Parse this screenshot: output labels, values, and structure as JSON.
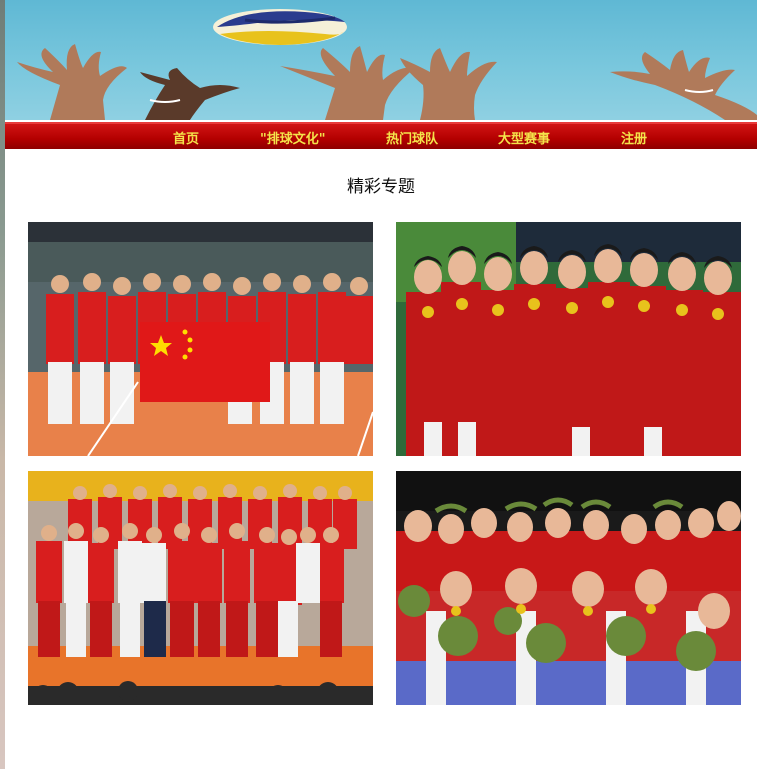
{
  "nav": {
    "items": [
      "首页",
      "\"排球文化\"",
      "热门球队",
      "大型赛事",
      "注册"
    ]
  },
  "section": {
    "title": "精彩专题"
  },
  "photos": [
    {
      "name": "photo-team-with-flag",
      "desc": ""
    },
    {
      "name": "photo-players-with-medals",
      "desc": ""
    },
    {
      "name": "photo-team-group",
      "desc": ""
    },
    {
      "name": "photo-medal-ceremony",
      "desc": ""
    }
  ],
  "colors": {
    "nav_bg": "#b30000",
    "nav_text": "#f4e34a",
    "jersey_red": "#d81e1e",
    "court_orange": "#e8814a"
  }
}
